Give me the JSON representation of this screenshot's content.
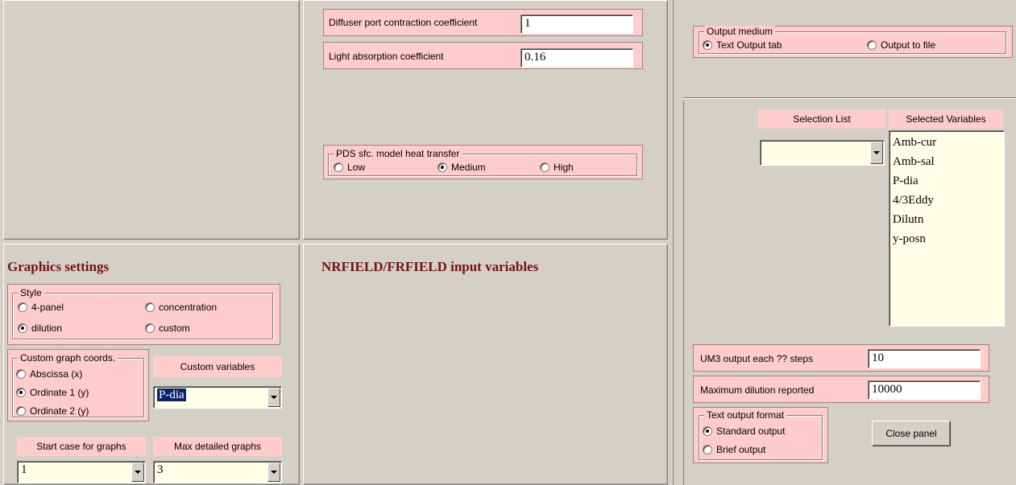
{
  "middle_top": {
    "diffuser": {
      "label": "Diffuser port contraction coefficient",
      "value": "1"
    },
    "light": {
      "label": "Light absorption coefficient",
      "value": "0.16"
    },
    "pds": {
      "legend": "PDS sfc. model heat transfer",
      "options": [
        {
          "label": "Low",
          "selected": false
        },
        {
          "label": "Medium",
          "selected": true
        },
        {
          "label": "High",
          "selected": false
        }
      ]
    }
  },
  "graphics": {
    "title": "Graphics settings",
    "style": {
      "legend": "Style",
      "options": [
        {
          "label": "4-panel",
          "selected": false
        },
        {
          "label": "concentration",
          "selected": false
        },
        {
          "label": "dilution",
          "selected": true
        },
        {
          "label": "custom",
          "selected": false
        }
      ]
    },
    "coords": {
      "legend": "Custom graph coords.",
      "options": [
        {
          "label": "Abscissa (x)",
          "selected": false
        },
        {
          "label": "Ordinate 1 (y)",
          "selected": true
        },
        {
          "label": "Ordinate 2 (y)",
          "selected": false
        }
      ]
    },
    "custom_variables": {
      "label": "Custom variables",
      "value": "P-dia"
    },
    "start_case": {
      "label": "Start case for graphs",
      "value": "1"
    },
    "max_detailed": {
      "label": "Max detailed graphs",
      "value": "3"
    }
  },
  "nrfield": {
    "title": "NRFIELD/FRFIELD input variables"
  },
  "right": {
    "output_medium": {
      "legend": "Output medium",
      "options": [
        {
          "label": "Text Output tab",
          "selected": true
        },
        {
          "label": "Output to file",
          "selected": false
        }
      ]
    },
    "selection_list": {
      "label": "Selection List",
      "value": ""
    },
    "selected_variables": {
      "label": "Selected Variables",
      "items": [
        "Amb-cur",
        "Amb-sal",
        "P-dia",
        "4/3Eddy",
        "Dilutn",
        "y-posn"
      ]
    },
    "um3_output": {
      "label": "UM3 output each ?? steps",
      "value": "10"
    },
    "max_dilution": {
      "label": "Maximum dilution reported",
      "value": "10000"
    },
    "text_format": {
      "legend": "Text output format",
      "options": [
        {
          "label": "Standard output",
          "selected": true
        },
        {
          "label": "Brief output",
          "selected": false
        }
      ]
    },
    "close_button": "Close panel"
  },
  "colors": {
    "panel_bg": "#d4d0c8",
    "label_bg": "#ffcccc",
    "heading": "#7a1010",
    "list_bg": "#ffffe8"
  }
}
